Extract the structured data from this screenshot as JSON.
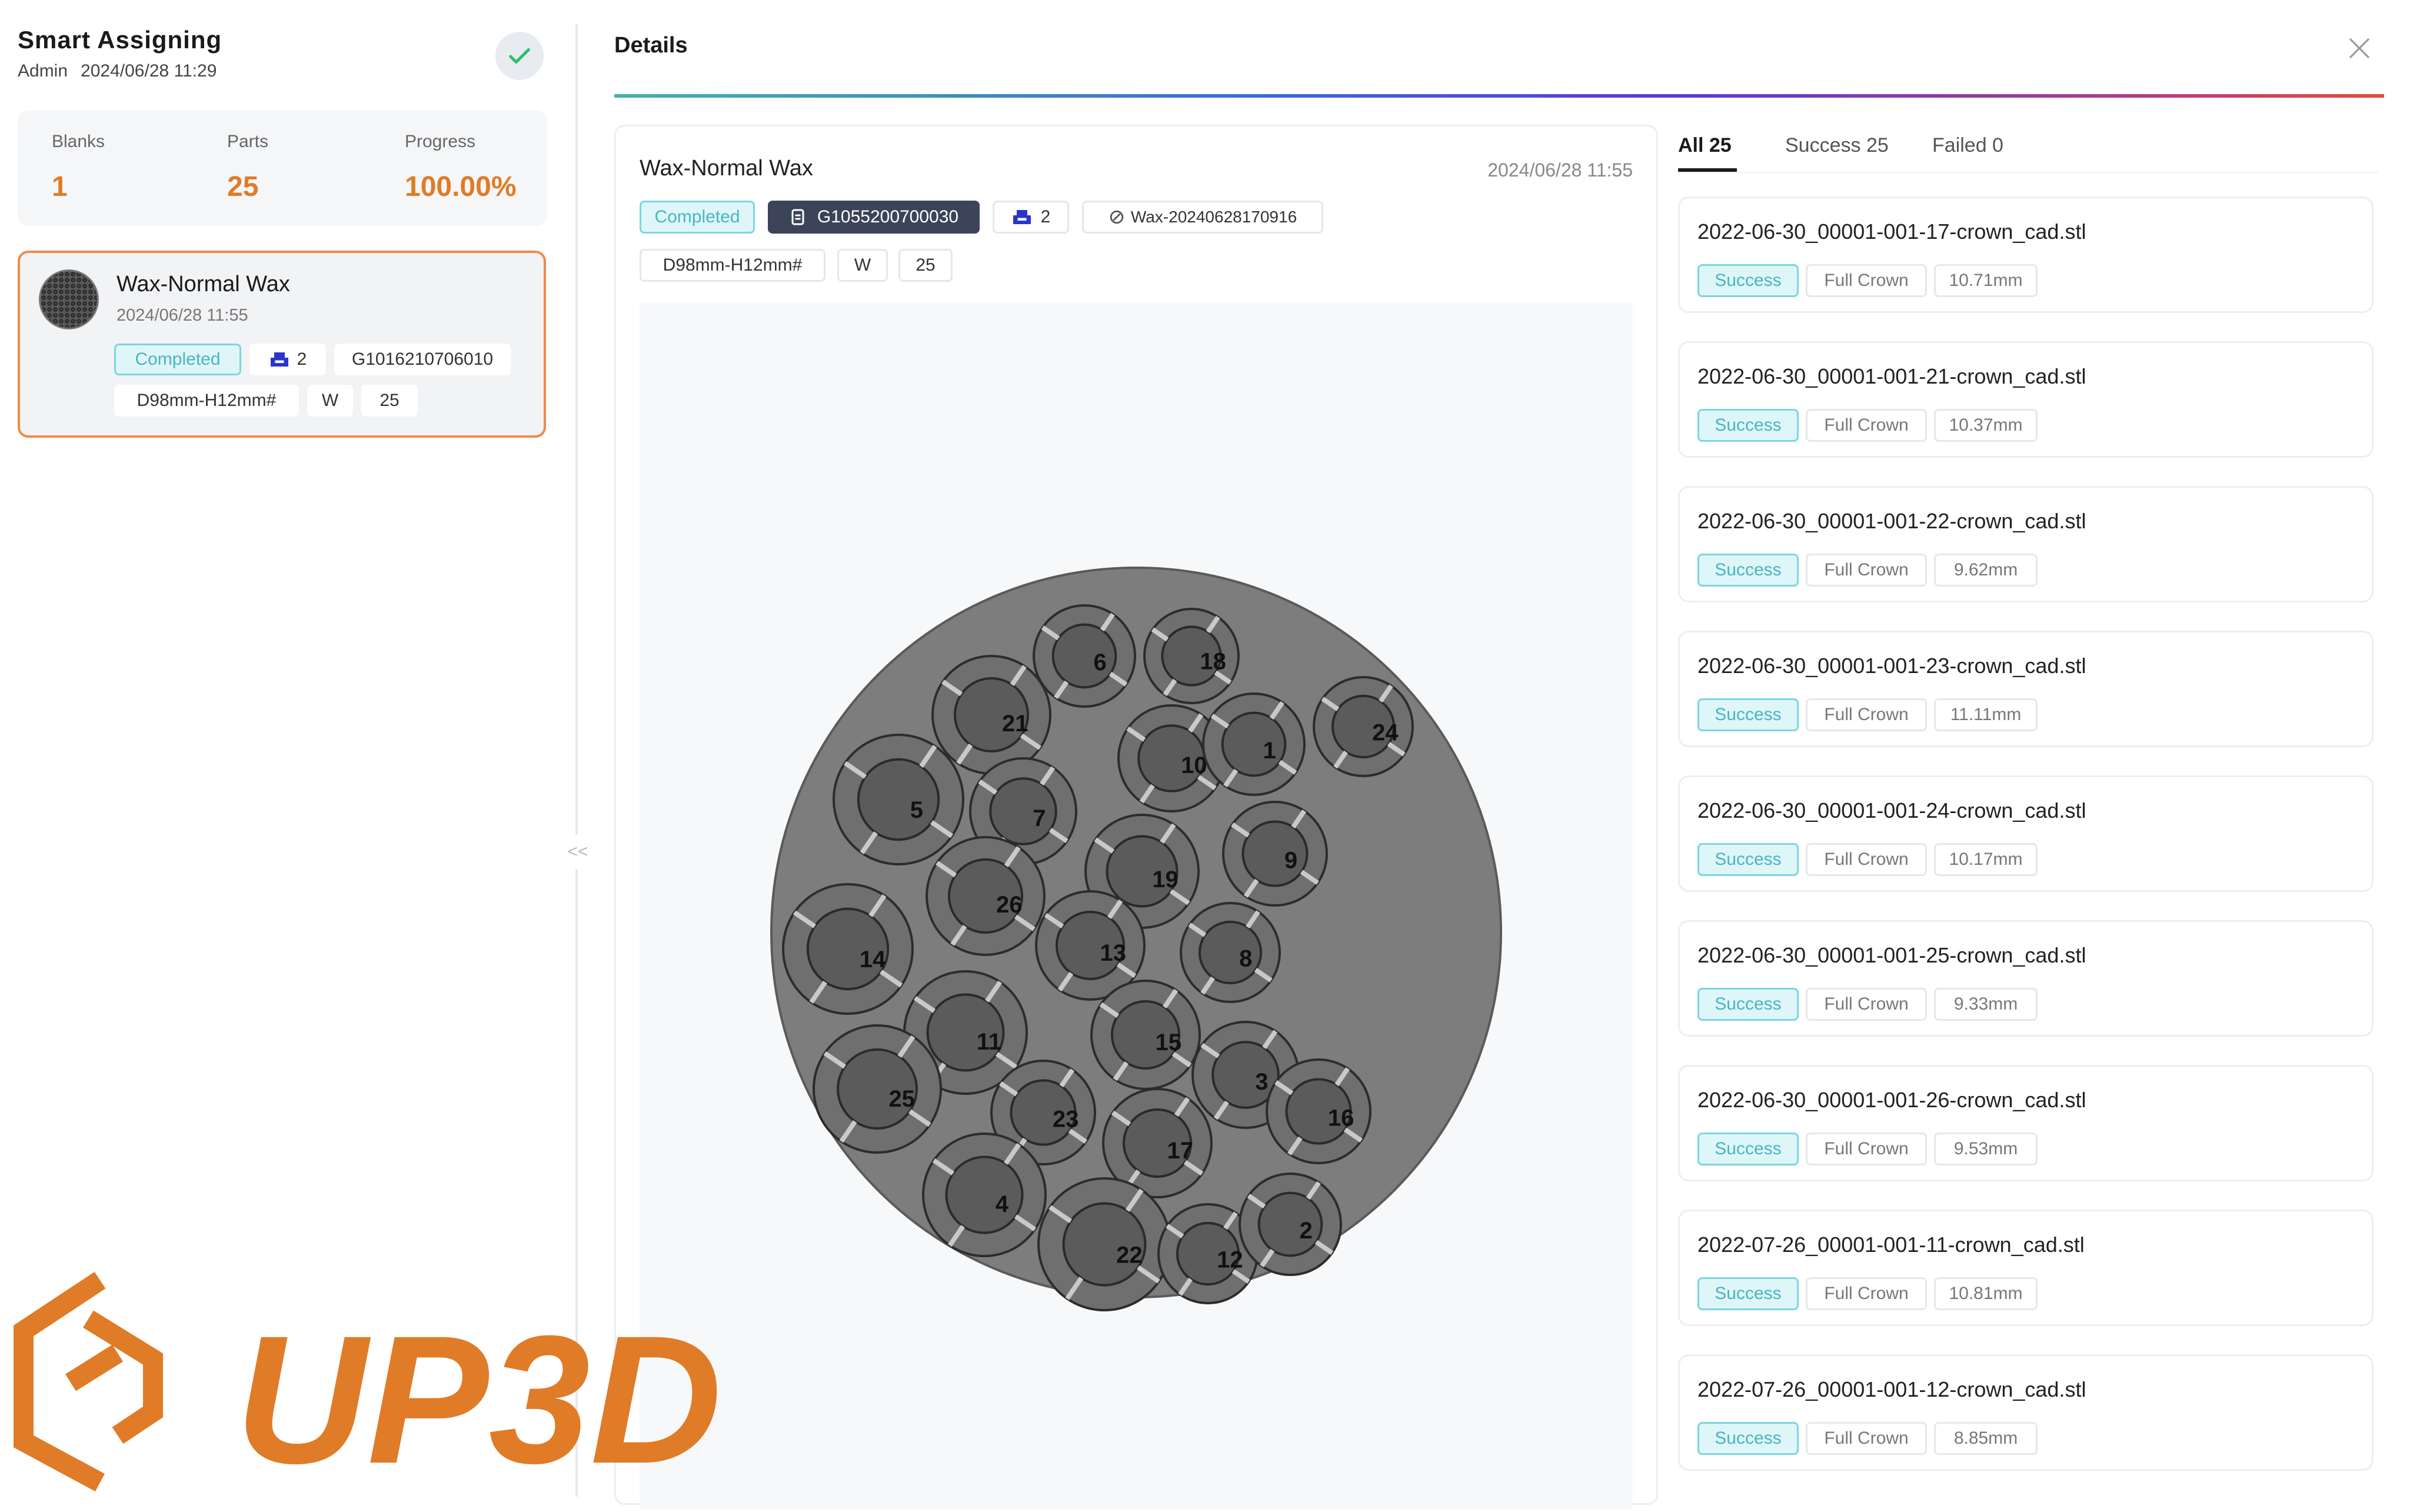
{
  "left_panel": {
    "title": "Smart Assigning",
    "user": "Admin",
    "datetime": "2024/06/28 11:29",
    "stats": {
      "blanks_label": "Blanks",
      "blanks_value": "1",
      "parts_label": "Parts",
      "parts_value": "25",
      "progress_label": "Progress",
      "progress_value": "100.00%"
    },
    "job": {
      "name": "Wax-Normal Wax",
      "date": "2024/06/28 11:55",
      "status": "Completed",
      "count": "2",
      "code": "G1016210706010",
      "blank_size": "D98mm-H12mm#",
      "material": "W",
      "parts": "25"
    },
    "collapse_label": "<<"
  },
  "details": {
    "title": "Details",
    "close": "×",
    "card": {
      "name": "Wax-Normal Wax",
      "time": "2024/06/28 11:55",
      "status": "Completed",
      "code": "G1055200700030",
      "count": "2",
      "file_ref": "Wax-20240628170916",
      "blank_size": "D98mm-H12mm#",
      "material": "W",
      "parts": "25"
    }
  },
  "tabs": {
    "all": "All 25",
    "success": "Success 25",
    "failed": "Failed 0"
  },
  "files": [
    {
      "name": "2022-06-30_00001-001-17-crown_cad.stl",
      "status": "Success",
      "kind": "Full Crown",
      "size": "10.71mm"
    },
    {
      "name": "2022-06-30_00001-001-21-crown_cad.stl",
      "status": "Success",
      "kind": "Full Crown",
      "size": "10.37mm"
    },
    {
      "name": "2022-06-30_00001-001-22-crown_cad.stl",
      "status": "Success",
      "kind": "Full Crown",
      "size": "9.62mm"
    },
    {
      "name": "2022-06-30_00001-001-23-crown_cad.stl",
      "status": "Success",
      "kind": "Full Crown",
      "size": "11.11mm"
    },
    {
      "name": "2022-06-30_00001-001-24-crown_cad.stl",
      "status": "Success",
      "kind": "Full Crown",
      "size": "10.17mm"
    },
    {
      "name": "2022-06-30_00001-001-25-crown_cad.stl",
      "status": "Success",
      "kind": "Full Crown",
      "size": "9.33mm"
    },
    {
      "name": "2022-06-30_00001-001-26-crown_cad.stl",
      "status": "Success",
      "kind": "Full Crown",
      "size": "9.53mm"
    },
    {
      "name": "2022-07-26_00001-001-11-crown_cad.stl",
      "status": "Success",
      "kind": "Full Crown",
      "size": "10.81mm"
    },
    {
      "name": "2022-07-26_00001-001-12-crown_cad.stl",
      "status": "Success",
      "kind": "Full Crown",
      "size": "8.85mm"
    }
  ],
  "plate_labels": [
    "21",
    "6",
    "18",
    "10",
    "1",
    "24",
    "5",
    "7",
    "9",
    "19",
    "26",
    "14",
    "13",
    "8",
    "11",
    "15",
    "23",
    "3",
    "25",
    "16",
    "17",
    "4",
    "22",
    "12",
    "2"
  ],
  "logo_text": "UP3D",
  "colors": {
    "accent_orange": "#e07b27",
    "success_cyan": "#46b6c3",
    "dark_tag": "#3b4458"
  }
}
